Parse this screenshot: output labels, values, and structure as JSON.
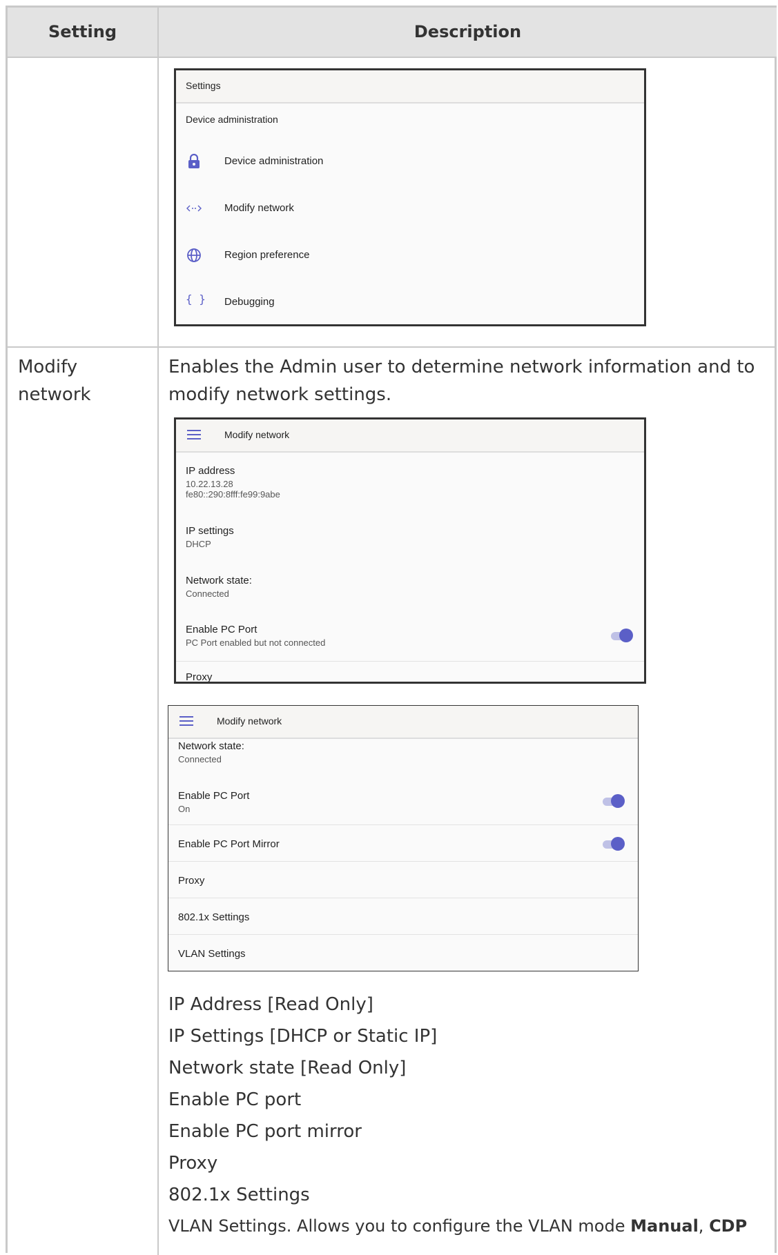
{
  "table": {
    "header_setting": "Setting",
    "header_description": "Description"
  },
  "shot1": {
    "title": "Settings",
    "section": "Device administration",
    "items": [
      {
        "label": "Device administration",
        "icon": "lock-icon"
      },
      {
        "label": "Modify network",
        "icon": "network-arrows-icon"
      },
      {
        "label": "Region preference",
        "icon": "globe-icon"
      },
      {
        "label": "Debugging",
        "icon": "braces-icon"
      }
    ]
  },
  "row2": {
    "setting": "Modify network",
    "description": "Enables the Admin user to determine network information and to modify network settings."
  },
  "shot2": {
    "title": "Modify network",
    "ip_address_label": "IP address",
    "ip_address_v4": "10.22.13.28",
    "ip_address_v6": "fe80::290:8fff:fe99:9abe",
    "ip_settings_label": "IP settings",
    "ip_settings_value": "DHCP",
    "network_state_label": "Network state:",
    "network_state_value": "Connected",
    "pc_port_label": "Enable PC Port",
    "pc_port_value": "PC Port enabled but not connected",
    "proxy_label": "Proxy"
  },
  "shot3": {
    "title": "Modify network",
    "network_state_label": "Network state:",
    "network_state_value": "Connected",
    "pc_port_label": "Enable PC Port",
    "pc_port_value": "On",
    "pc_port_mirror_label": "Enable PC Port Mirror",
    "proxy_label": "Proxy",
    "dot1x_label": "802.1x Settings",
    "vlan_label": "VLAN Settings"
  },
  "list": {
    "item1": "IP Address [Read Only]",
    "item2": "IP Settings [DHCP or Static IP]",
    "item3": "Network state [Read Only]",
    "item4": "Enable PC port",
    "item5": "Enable PC port mirror",
    "item6": "Proxy",
    "item7": "802.1x Settings",
    "item8_prefix": "VLAN Settings. Allows you to configure the VLAN mode ",
    "item8_bold1": "Manual",
    "item8_sep": ", ",
    "item8_bold2": "CDP"
  },
  "colors": {
    "accent": "#5b5fc7",
    "toggle_track": "#bfc1e6",
    "border": "#c9c9c9",
    "header_bg": "#e3e3e3"
  }
}
